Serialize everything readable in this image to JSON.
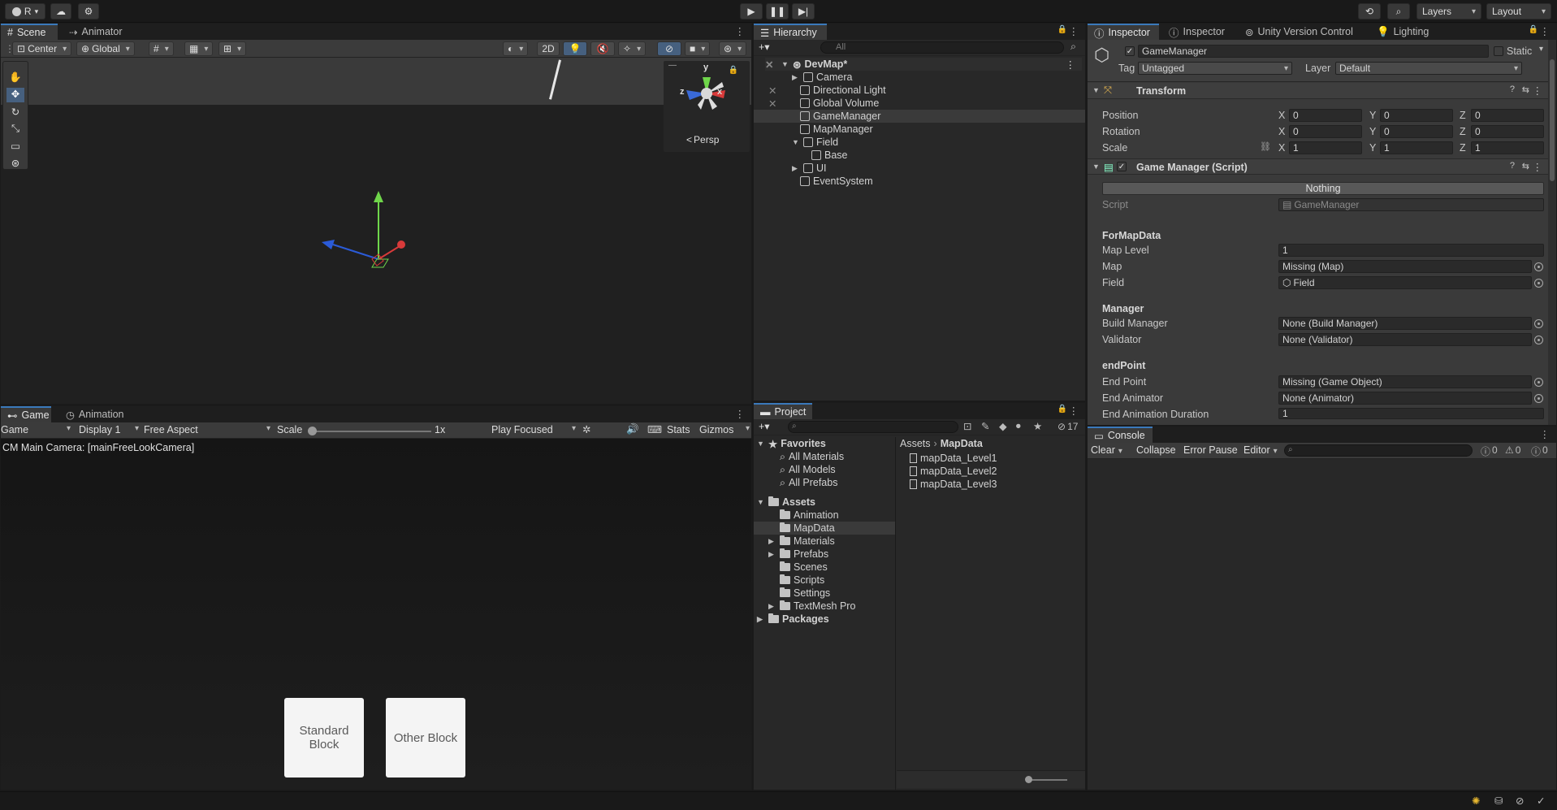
{
  "toolbar": {
    "account": "R",
    "layers": "Layers",
    "layout": "Layout"
  },
  "scene": {
    "tabs": [
      "Scene",
      "Animator"
    ],
    "pivot": "Center",
    "space": "Global",
    "two_d": "2D",
    "gizmo_persp": "Persp",
    "gizmo_y": "y",
    "gizmo_z": "z",
    "gizmo_x": "x"
  },
  "game": {
    "tabs": [
      "Game",
      "Animation"
    ],
    "mode": "Game",
    "display": "Display 1",
    "aspect": "Free Aspect",
    "scale_label": "Scale",
    "scale_value": "1x",
    "play_focused": "Play Focused",
    "stats": "Stats",
    "gizmos": "Gizmos",
    "camera_text": "CM Main Camera: [mainFreeLookCamera]",
    "btn_standard": "Standard Block",
    "btn_other": "Other Block"
  },
  "hierarchy": {
    "title": "Hierarchy",
    "search_placeholder": "All",
    "scene_name": "DevMap*",
    "items": [
      "Camera",
      "Directional Light",
      "Global Volume",
      "GameManager",
      "MapManager",
      "Field",
      "Base",
      "UI",
      "EventSystem"
    ]
  },
  "project": {
    "title": "Project",
    "badge": "17",
    "favorites": "Favorites",
    "fav_items": [
      "All Materials",
      "All Models",
      "All Prefabs"
    ],
    "assets": "Assets",
    "asset_folders": [
      "Animation",
      "MapData",
      "Materials",
      "Prefabs",
      "Scenes",
      "Scripts",
      "Settings",
      "TextMesh Pro"
    ],
    "packages": "Packages",
    "breadcrumb_root": "Assets",
    "breadcrumb_current": "MapData",
    "files": [
      "mapData_Level1",
      "mapData_Level2",
      "mapData_Level3"
    ]
  },
  "inspector": {
    "tabs": [
      "Inspector",
      "Inspector",
      "Unity Version Control",
      "Lighting"
    ],
    "object_name": "GameManager",
    "static": "Static",
    "tag_label": "Tag",
    "tag_value": "Untagged",
    "layer_label": "Layer",
    "layer_value": "Default",
    "transform": {
      "title": "Transform",
      "rows": [
        {
          "label": "Position",
          "x": "0",
          "y": "0",
          "z": "0"
        },
        {
          "label": "Rotation",
          "x": "0",
          "y": "0",
          "z": "0"
        },
        {
          "label": "Scale",
          "x": "1",
          "y": "1",
          "z": "1"
        }
      ],
      "axis_x": "X",
      "axis_y": "Y",
      "axis_z": "Z"
    },
    "script": {
      "title": "Game Manager (Script)",
      "nothing": "Nothing",
      "script_label": "Script",
      "script_value": "GameManager",
      "h_formapdata": "ForMapData",
      "map_level_label": "Map Level",
      "map_level_value": "1",
      "map_label": "Map",
      "map_value": "Missing (Map)",
      "field_label": "Field",
      "field_value": "Field",
      "h_manager": "Manager",
      "build_label": "Build Manager",
      "build_value": "None (Build Manager)",
      "validator_label": "Validator",
      "validator_value": "None (Validator)",
      "h_endpoint": "endPoint",
      "endpoint_label": "End Point",
      "endpoint_value": "Missing (Game Object)",
      "endanim_label": "End Animator",
      "endanim_value": "None (Animator)",
      "enddur_label": "End Animation Duration",
      "enddur_value": "1"
    }
  },
  "console": {
    "title": "Console",
    "clear": "Clear",
    "collapse": "Collapse",
    "error_pause": "Error Pause",
    "editor": "Editor",
    "count_log": "0",
    "count_warn": "0",
    "count_err": "0"
  },
  "colors": {
    "accent": "#3a79bb",
    "panel": "#282828",
    "toolbar": "#3b3b3b",
    "selection": "#3a3a3a"
  }
}
